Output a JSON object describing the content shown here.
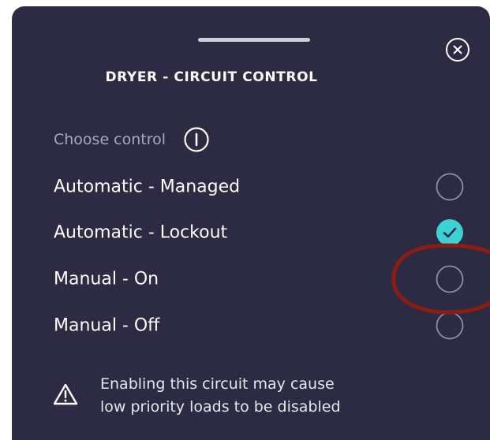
{
  "sheet": {
    "title": "DRYER - CIRCUIT CONTROL",
    "close_icon": "close-circle-icon",
    "choose_label": "Choose control",
    "info_icon": "info-circle-icon"
  },
  "options": [
    {
      "label": "Automatic - Managed",
      "selected": false
    },
    {
      "label": "Automatic - Lockout",
      "selected": true
    },
    {
      "label": "Manual - On",
      "selected": false
    },
    {
      "label": "Manual - Off",
      "selected": false
    }
  ],
  "warning": {
    "icon": "warning-triangle-icon",
    "line1": "Enabling this circuit may cause",
    "line2": "low priority loads to be disabled"
  },
  "colors": {
    "background": "#2c2b43",
    "accent": "#3ed1d3",
    "annotation": "#8b1c14"
  }
}
